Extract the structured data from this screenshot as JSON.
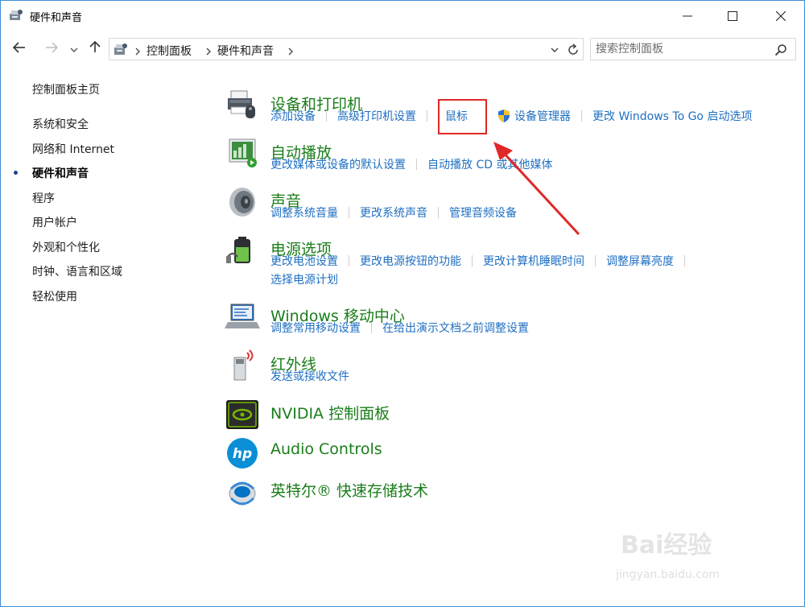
{
  "window": {
    "title": "硬件和声音",
    "controls": {
      "minimize": "minimize-icon",
      "maximize": "maximize-icon",
      "close": "close-icon"
    }
  },
  "nav": {
    "breadcrumbs": [
      "控制面板",
      "硬件和声音"
    ],
    "search_placeholder": "搜索控制面板"
  },
  "sidebar": {
    "items": [
      {
        "label": "控制面板主页",
        "active": false
      },
      {
        "label": "系统和安全",
        "active": false
      },
      {
        "label": "网络和 Internet",
        "active": false
      },
      {
        "label": "硬件和声音",
        "active": true
      },
      {
        "label": "程序",
        "active": false
      },
      {
        "label": "用户帐户",
        "active": false
      },
      {
        "label": "外观和个性化",
        "active": false
      },
      {
        "label": "时钟、语言和区域",
        "active": false
      },
      {
        "label": "轻松使用",
        "active": false
      }
    ]
  },
  "categories": [
    {
      "title": "设备和打印机",
      "icon": "printer-icon",
      "links": [
        "添加设备",
        "高级打印机设置",
        "鼠标",
        "设备管理器",
        "更改 Windows To Go 启动选项"
      ]
    },
    {
      "title": "自动播放",
      "icon": "autoplay-icon",
      "links": [
        "更改媒体或设备的默认设置",
        "自动播放 CD 或其他媒体"
      ]
    },
    {
      "title": "声音",
      "icon": "speaker-icon",
      "links": [
        "调整系统音量",
        "更改系统声音",
        "管理音频设备"
      ]
    },
    {
      "title": "电源选项",
      "icon": "battery-icon",
      "links": [
        "更改电池设置",
        "更改电源按钮的功能",
        "更改计算机睡眠时间",
        "调整屏幕亮度",
        "选择电源计划"
      ]
    },
    {
      "title": "Windows 移动中心",
      "icon": "mobility-center-icon",
      "links": [
        "调整常用移动设置",
        "在给出演示文档之前调整设置"
      ]
    },
    {
      "title": "红外线",
      "icon": "infrared-icon",
      "links": [
        "发送或接收文件"
      ]
    },
    {
      "title": "NVIDIA 控制面板",
      "icon": "nvidia-icon",
      "links": []
    },
    {
      "title": "Audio Controls",
      "icon": "hp-icon",
      "links": []
    },
    {
      "title": "英特尔® 快速存储技术",
      "icon": "intel-rst-icon",
      "links": []
    }
  ],
  "annotation": {
    "highlight_color": "#e02828"
  },
  "watermark": {
    "line1": "Bai经验",
    "line2": "jingyan.baidu.com"
  },
  "colors": {
    "title_green": "#1a7d1a",
    "link_blue": "#1f6fc1",
    "border_blue": "#3c8fd6"
  }
}
